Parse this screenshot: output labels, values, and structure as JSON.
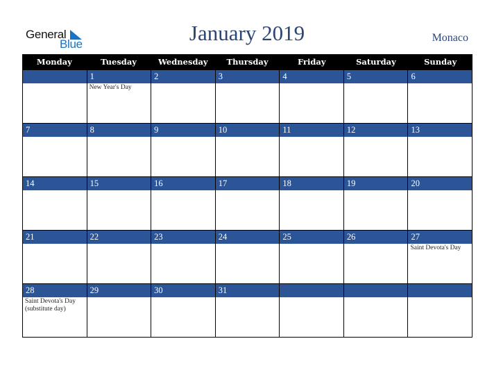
{
  "logo": {
    "general": "General",
    "blue": "Blue"
  },
  "title": "January 2019",
  "country": "Monaco",
  "weekdays": [
    "Monday",
    "Tuesday",
    "Wednesday",
    "Thursday",
    "Friday",
    "Saturday",
    "Sunday"
  ],
  "weeks": [
    [
      {
        "day": "",
        "events": ""
      },
      {
        "day": "1",
        "events": "New Year's Day"
      },
      {
        "day": "2",
        "events": ""
      },
      {
        "day": "3",
        "events": ""
      },
      {
        "day": "4",
        "events": ""
      },
      {
        "day": "5",
        "events": ""
      },
      {
        "day": "6",
        "events": ""
      }
    ],
    [
      {
        "day": "7",
        "events": ""
      },
      {
        "day": "8",
        "events": ""
      },
      {
        "day": "9",
        "events": ""
      },
      {
        "day": "10",
        "events": ""
      },
      {
        "day": "11",
        "events": ""
      },
      {
        "day": "12",
        "events": ""
      },
      {
        "day": "13",
        "events": ""
      }
    ],
    [
      {
        "day": "14",
        "events": ""
      },
      {
        "day": "15",
        "events": ""
      },
      {
        "day": "16",
        "events": ""
      },
      {
        "day": "17",
        "events": ""
      },
      {
        "day": "18",
        "events": ""
      },
      {
        "day": "19",
        "events": ""
      },
      {
        "day": "20",
        "events": ""
      }
    ],
    [
      {
        "day": "21",
        "events": ""
      },
      {
        "day": "22",
        "events": ""
      },
      {
        "day": "23",
        "events": ""
      },
      {
        "day": "24",
        "events": ""
      },
      {
        "day": "25",
        "events": ""
      },
      {
        "day": "26",
        "events": ""
      },
      {
        "day": "27",
        "events": "Saint Devota's Day"
      }
    ],
    [
      {
        "day": "28",
        "events": "Saint Devota's Day (substitute day)"
      },
      {
        "day": "29",
        "events": ""
      },
      {
        "day": "30",
        "events": ""
      },
      {
        "day": "31",
        "events": ""
      },
      {
        "day": "",
        "events": ""
      },
      {
        "day": "",
        "events": ""
      },
      {
        "day": "",
        "events": ""
      }
    ]
  ]
}
